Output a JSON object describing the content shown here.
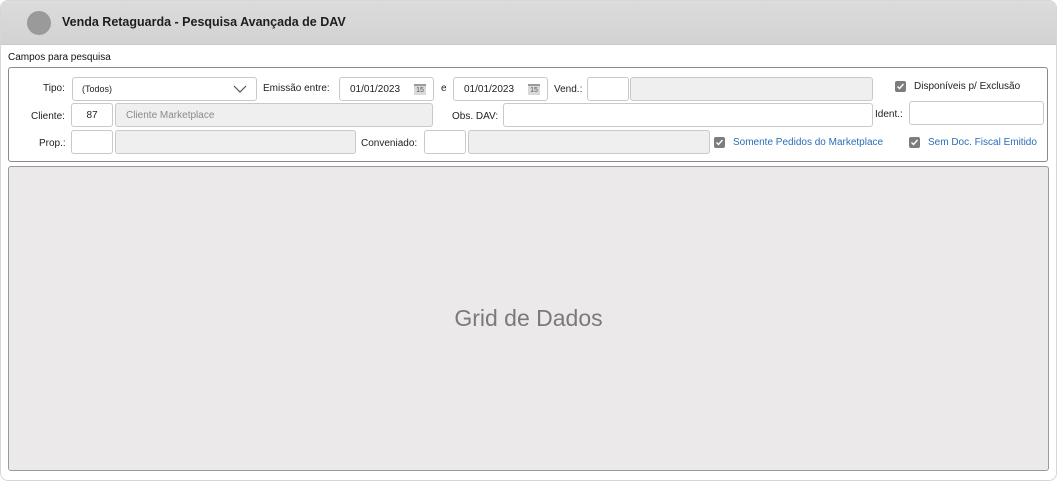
{
  "window": {
    "title": "Venda Retaguarda - Pesquisa Avançada de DAV"
  },
  "section": {
    "label": "Campos para pesquisa"
  },
  "form": {
    "tipo": {
      "label": "Tipo:",
      "value": "(Todos)"
    },
    "emissao": {
      "label": "Emissão entre:",
      "start": "01/01/2023",
      "separator": "e",
      "end": "01/01/2023",
      "calendar_glyph": "15"
    },
    "vend": {
      "label": "Vend.:",
      "code": "",
      "name": ""
    },
    "cliente": {
      "label": "Cliente:",
      "code": "87",
      "name": "Cliente Marketplace"
    },
    "obs_dav": {
      "label": "Obs. DAV:",
      "value": ""
    },
    "ident": {
      "label": "Ident.:",
      "value": ""
    },
    "prop": {
      "label": "Prop.:",
      "code": "",
      "name": ""
    },
    "conveniado": {
      "label": "Conveniado:",
      "code": "",
      "name": ""
    },
    "checks": {
      "disponiveis": {
        "label": "Disponíveis p/ Exclusão",
        "checked": true
      },
      "somente_marketplace": {
        "label": "Somente Pedidos do Marketplace",
        "checked": true
      },
      "sem_doc_fiscal": {
        "label": "Sem Doc. Fiscal Emitido",
        "checked": true
      }
    }
  },
  "grid": {
    "placeholder": "Grid de Dados"
  },
  "colors": {
    "link_blue": "#2a6db8",
    "grid_bg": "#ebe9ea",
    "titlebar": "#d6d6d6"
  }
}
